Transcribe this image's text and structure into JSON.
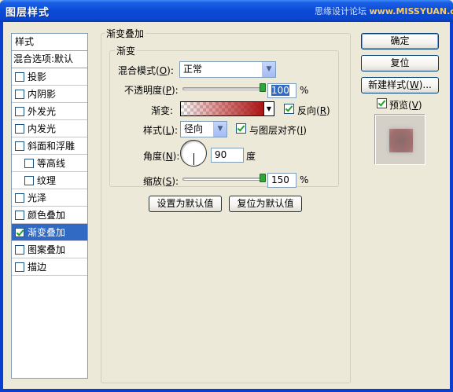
{
  "window": {
    "title": "图层样式",
    "watermark_prefix": "思缘设计论坛",
    "watermark_site": "www.MISSYUAN.com"
  },
  "styles_panel": {
    "header": "样式",
    "blend_options": "混合选项:默认",
    "items": [
      {
        "label": "投影",
        "checked": false,
        "sub": false,
        "selected": false
      },
      {
        "label": "内阴影",
        "checked": false,
        "sub": false,
        "selected": false
      },
      {
        "label": "外发光",
        "checked": false,
        "sub": false,
        "selected": false
      },
      {
        "label": "内发光",
        "checked": false,
        "sub": false,
        "selected": false
      },
      {
        "label": "斜面和浮雕",
        "checked": false,
        "sub": false,
        "selected": false
      },
      {
        "label": "等高线",
        "checked": false,
        "sub": true,
        "selected": false
      },
      {
        "label": "纹理",
        "checked": false,
        "sub": true,
        "selected": false
      },
      {
        "label": "光泽",
        "checked": false,
        "sub": false,
        "selected": false
      },
      {
        "label": "颜色叠加",
        "checked": false,
        "sub": false,
        "selected": false
      },
      {
        "label": "渐变叠加",
        "checked": true,
        "sub": false,
        "selected": true
      },
      {
        "label": "图案叠加",
        "checked": false,
        "sub": false,
        "selected": false
      },
      {
        "label": "描边",
        "checked": false,
        "sub": false,
        "selected": false
      }
    ]
  },
  "gradient_overlay": {
    "group_title": "渐变叠加",
    "sub_title": "渐变",
    "blend_mode_label": "混合模式(",
    "blend_mode_key": "O",
    "blend_mode_value": "正常",
    "opacity_label": "不透明度(",
    "opacity_key": "P",
    "opacity_value": "100",
    "opacity_level": 1.0,
    "percent_sign": "%",
    "gradient_label": "渐变:",
    "reverse_label": "反向(",
    "reverse_key": "R",
    "reverse_checked": true,
    "style_label": "样式(",
    "style_key": "L",
    "style_value": "径向",
    "align_label": "与图层对齐(",
    "align_key": "I",
    "align_checked": true,
    "angle_label": "角度(",
    "angle_key": "N",
    "angle_value": "90",
    "angle_unit": "度",
    "scale_label": "缩放(",
    "scale_key": "S",
    "scale_value": "150",
    "scale_level": 1.0,
    "close_paren": "):",
    "close_paren_plain": ")",
    "make_default_btn": "设置为默认值",
    "reset_default_btn": "复位为默认值",
    "gradient_color": "#b41e1e"
  },
  "buttons": {
    "ok": "确定",
    "reset": "复位",
    "new_style": "新建样式(",
    "new_style_key": "W",
    "new_style_tail": ")...",
    "preview_label": "预览(",
    "preview_key": "V",
    "preview_checked": true
  }
}
